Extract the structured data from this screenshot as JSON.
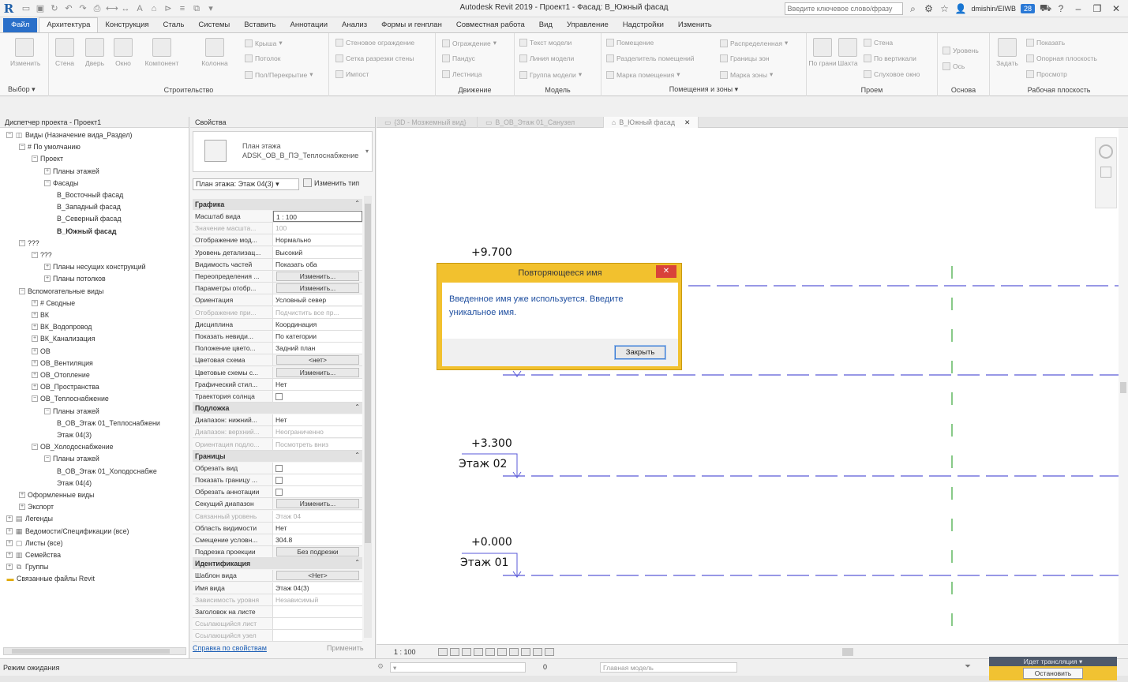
{
  "title_bar": {
    "window_title": "Autodesk Revit 2019 - Проект1 - Фасад: В_Южный фасад",
    "search_placeholder": "Введите ключевое слово/фразу",
    "user": "dmishin/EIWB",
    "badge": "28"
  },
  "ribbon": {
    "tabs": [
      {
        "label": "Файл"
      },
      {
        "label": "Архитектура"
      },
      {
        "label": "Конструкция"
      },
      {
        "label": "Сталь"
      },
      {
        "label": "Системы"
      },
      {
        "label": "Вставить"
      },
      {
        "label": "Аннотации"
      },
      {
        "label": "Анализ"
      },
      {
        "label": "Формы и генплан"
      },
      {
        "label": "Совместная работа"
      },
      {
        "label": "Вид"
      },
      {
        "label": "Управление"
      },
      {
        "label": "Надстройки"
      },
      {
        "label": "Изменить"
      }
    ],
    "groups": {
      "select": "Выбор",
      "build": "Строительство",
      "circulation": "Движение",
      "model": "Модель",
      "room_area": "Помещения и зоны",
      "opening": "Проем",
      "datum": "Основа",
      "workplane": "Рабочая плоскость"
    },
    "buttons": {
      "modify": "Изменить",
      "wall": "Стена",
      "door": "Дверь",
      "window": "Окно",
      "component": "Компонент",
      "column": "Колонна",
      "roof": "Крыша",
      "ceiling": "Потолок",
      "floor": "Пол/Перекрытие",
      "curtain_system": "Стеновое ограждение",
      "curtain_grid": "Сетка разрезки стены",
      "mullion": "Импост",
      "railing": "Ограждение",
      "ramp": "Пандус",
      "stair": "Лестница",
      "model_text": "Текст модели",
      "model_line": "Линия модели",
      "model_group": "Группа модели",
      "room": "Помещение",
      "room_separator": "Разделитель помещений",
      "room_tag": "Марка помещения",
      "area": "Распределенная",
      "area_boundary": "Границы зон",
      "area_tag": "Марка зоны",
      "by_face": "По грани",
      "shaft": "Шахта",
      "wall_opening": "Стена",
      "vertical": "По вертикали",
      "dormer": "Слуховое окно",
      "level": "Уровень",
      "grid": "Ось",
      "set": "Задать",
      "show": "Показать",
      "ref_plane": "Опорная плоскость",
      "viewer": "Просмотр"
    }
  },
  "browser": {
    "title": "Диспетчер проекта - Проект1",
    "items": [
      {
        "label": "Виды (Назначение вида_Раздел)"
      },
      {
        "label": "# По умолчанию"
      },
      {
        "label": "Проект"
      },
      {
        "label": "Планы этажей"
      },
      {
        "label": "Фасады"
      },
      {
        "label": "В_Восточный фасад"
      },
      {
        "label": "В_Западный фасад"
      },
      {
        "label": "В_Северный фасад"
      },
      {
        "label": "В_Южный фасад"
      },
      {
        "label": "???"
      },
      {
        "label": "???"
      },
      {
        "label": "Планы несущих конструкций"
      },
      {
        "label": "Планы потолков"
      },
      {
        "label": "Вспомогательные виды"
      },
      {
        "label": "# Сводные"
      },
      {
        "label": "ВК"
      },
      {
        "label": "ВК_Водопровод"
      },
      {
        "label": "ВК_Канализация"
      },
      {
        "label": "ОВ"
      },
      {
        "label": "ОВ_Вентиляция"
      },
      {
        "label": "ОВ_Отопление"
      },
      {
        "label": "ОВ_Пространства"
      },
      {
        "label": "ОВ_Теплоснабжение"
      },
      {
        "label": "Планы этажей"
      },
      {
        "label": "В_ОВ_Этаж 01_Теплоснабжени"
      },
      {
        "label": "Этаж 04(3)"
      },
      {
        "label": "ОВ_Холодоснабжение"
      },
      {
        "label": "Планы этажей"
      },
      {
        "label": "В_ОВ_Этаж 01_Холодоснабже"
      },
      {
        "label": "Этаж 04(4)"
      },
      {
        "label": "Оформленные виды"
      },
      {
        "label": "Экспорт"
      },
      {
        "label": "Легенды"
      },
      {
        "label": "Ведомости/Спецификации (все)"
      },
      {
        "label": "Листы (все)"
      },
      {
        "label": "Семейства"
      },
      {
        "label": "Группы"
      },
      {
        "label": "Связанные файлы Revit"
      }
    ]
  },
  "properties": {
    "title": "Свойства",
    "type_line1": "План этажа",
    "type_line2": "ADSK_ОВ_В_ПЭ_Теплоснабжение",
    "instance": "План этажа: Этаж 04(3)",
    "edit_type": "Изменить тип",
    "sections": {
      "graphics": "Графика",
      "underlay": "Подложка",
      "extents": "Границы",
      "identity": "Идентификация"
    },
    "rows": [
      {
        "name": "Масштаб вида",
        "value": "1 : 100"
      },
      {
        "name": "Значение масшта...",
        "value": "100"
      },
      {
        "name": "Отображение мод...",
        "value": "Нормально"
      },
      {
        "name": "Уровень детализац...",
        "value": "Высокий"
      },
      {
        "name": "Видимость частей",
        "value": "Показать оба"
      },
      {
        "name": "Переопределения ...",
        "value": "Изменить..."
      },
      {
        "name": "Параметры отобр...",
        "value": "Изменить..."
      },
      {
        "name": "Ориентация",
        "value": "Условный север"
      },
      {
        "name": "Отображение при...",
        "value": "Подчистить все пр..."
      },
      {
        "name": "Дисциплина",
        "value": "Координация"
      },
      {
        "name": "Показать невиди...",
        "value": "По категории"
      },
      {
        "name": "Положение цвето...",
        "value": "Задний план"
      },
      {
        "name": "Цветовая схема",
        "value": "<нет>"
      },
      {
        "name": "Цветовые схемы с...",
        "value": "Изменить..."
      },
      {
        "name": "Графический стил...",
        "value": "Нет"
      },
      {
        "name": "Траектория солнца",
        "value": ""
      },
      {
        "name": "Диапазон: нижний...",
        "value": "Нет"
      },
      {
        "name": "Диапазон: верхний...",
        "value": "Неограниченно"
      },
      {
        "name": "Ориентация подло...",
        "value": "Посмотреть вниз"
      },
      {
        "name": "Обрезать вид",
        "value": ""
      },
      {
        "name": "Показать границу ...",
        "value": ""
      },
      {
        "name": "Обрезать аннотации",
        "value": ""
      },
      {
        "name": "Секущий диапазон",
        "value": "Изменить..."
      },
      {
        "name": "Связанный уровень",
        "value": "Этаж 04"
      },
      {
        "name": "Область видимости",
        "value": "Нет"
      },
      {
        "name": "Смещение условн...",
        "value": "304.8"
      },
      {
        "name": "Подрезка проекции",
        "value": "Без подрезки"
      },
      {
        "name": "Шаблон вида",
        "value": "<Нет>"
      },
      {
        "name": "Имя вида",
        "value": "Этаж 04(3)"
      },
      {
        "name": "Зависимость уровня",
        "value": "Независимый"
      },
      {
        "name": "Заголовок на листе",
        "value": ""
      },
      {
        "name": "Ссылающийся лист",
        "value": ""
      },
      {
        "name": "Ссылающийся узел",
        "value": ""
      }
    ],
    "help_link": "Справка по свойствам",
    "apply": "Применить"
  },
  "view_tabs": [
    {
      "label": "{3D - Мозжемный вид}"
    },
    {
      "label": "В_ОВ_Этаж 01_Санузел"
    },
    {
      "label": "В_Южный фасад"
    }
  ],
  "canvas": {
    "levels": [
      {
        "elevation": "+9.700",
        "name": ""
      },
      {
        "elevation": "+3.300",
        "name": "Этаж 02"
      },
      {
        "elevation": "+0.000",
        "name": "Этаж 01"
      }
    ],
    "line_color": "#5a5ad8",
    "grid_color": "#3aa63a"
  },
  "view_bar": {
    "scale": "1 : 100"
  },
  "status_bar": {
    "text": "Режим ожидания",
    "model_dropdown": "Главная модель",
    "zero": "0"
  },
  "broadcast": {
    "title": "Идет трансляция",
    "stop": "Остановить"
  },
  "dialog": {
    "title": "Повторяющееся имя",
    "message": "Введенное имя уже используется. Введите уникальное имя.",
    "close_button": "Закрыть",
    "close_x": "✕"
  }
}
